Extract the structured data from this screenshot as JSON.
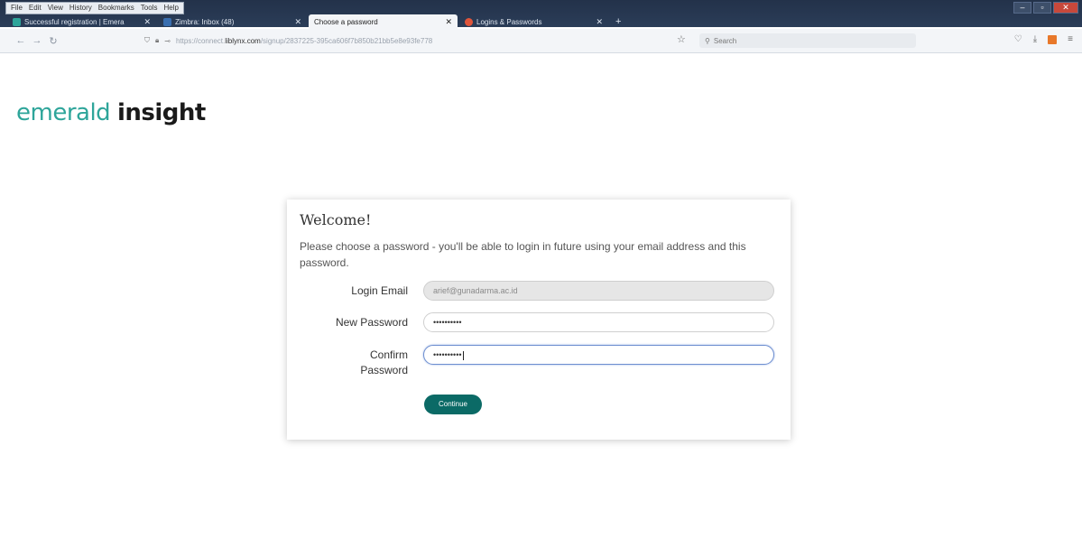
{
  "browser": {
    "menu": [
      "File",
      "Edit",
      "View",
      "History",
      "Bookmarks",
      "Tools",
      "Help"
    ],
    "tabs": [
      {
        "title": "Successful registration | Emera",
        "icon_color": "#2ea59a",
        "active": false
      },
      {
        "title": "Zimbra: Inbox (48)",
        "icon_color": "#3a6fb0",
        "active": false
      },
      {
        "title": "Choose a password",
        "icon_color": "#ffffff",
        "active": true
      },
      {
        "title": "Logins & Passwords",
        "icon_color": "#e0553a",
        "active": false
      }
    ],
    "new_tab": "+",
    "url_prefix": "https://connect.",
    "url_host": "liblynx.com",
    "url_rest": "/signup/2837225-395ca606f7b850b21bb5e8e93fe778",
    "search_placeholder": "Search"
  },
  "logo": {
    "part1": "emerald",
    "part2": "insight"
  },
  "card": {
    "title": "Welcome!",
    "intro": "Please choose a password - you'll be able to login in future using your email address and this password.",
    "login_email_label": "Login Email",
    "login_email_value": "arief@gunadarma.ac.id",
    "new_password_label": "New Password",
    "new_password_value": "••••••••••",
    "confirm_label_line1": "Confirm",
    "confirm_label_line2": "Password",
    "confirm_password_value": "••••••••••",
    "continue_label": "Continue"
  },
  "colors": {
    "brand": "#2ea59a",
    "button": "#0b6a66"
  }
}
